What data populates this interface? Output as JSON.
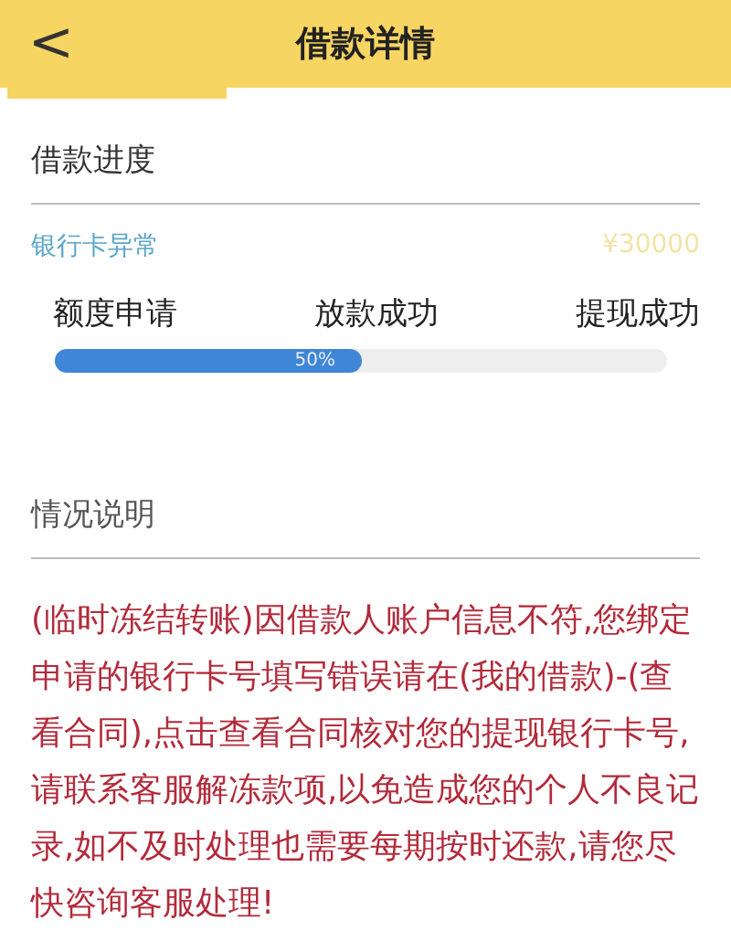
{
  "header": {
    "back": "<",
    "title": "借款详情"
  },
  "progress_section": {
    "title": "借款进度",
    "status": "银行卡异常",
    "amount": "¥30000",
    "steps": [
      "额度申请",
      "放款成功",
      "提现成功"
    ],
    "progress": {
      "level": 0.5,
      "reading": "50%"
    }
  },
  "details_section": {
    "title": "情况说明",
    "text": "(临时冻结转账)因借款人账户信息不符,您绑定申请的银行卡号填写错误请在(我的借款)-(查看合同),点击查看合同核对您的提现银行卡号,请联系客服解冻款项,以免造成您的个人不良记录,如不及时处理也需要每期按时还款,请您尽快咨询客服处理!"
  }
}
